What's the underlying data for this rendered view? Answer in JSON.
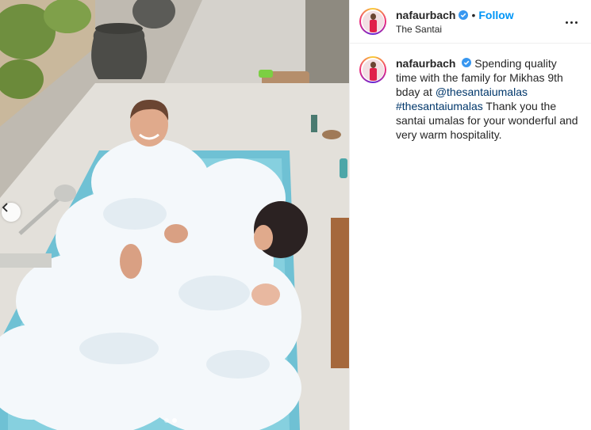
{
  "post": {
    "username": "nafaurbach",
    "verified": true,
    "follow_label": "Follow",
    "location": "The Santai",
    "separator": "•",
    "media": {
      "image_description": "bubble-bath",
      "carousel_total": 2,
      "carousel_active": 2
    },
    "caption": {
      "text_1": "Spending quality time with the family for Mikhas 9th bday at",
      "mention": "@thesantaiumalas",
      "hashtag": "#thesantaiumalas",
      "text_2": "Thank you the santai umalas for your wonderful and very warm hospitality."
    }
  },
  "colors": {
    "accent": "#0095f6",
    "link": "#00376b",
    "verified": "#3897f0",
    "text": "#262626"
  }
}
